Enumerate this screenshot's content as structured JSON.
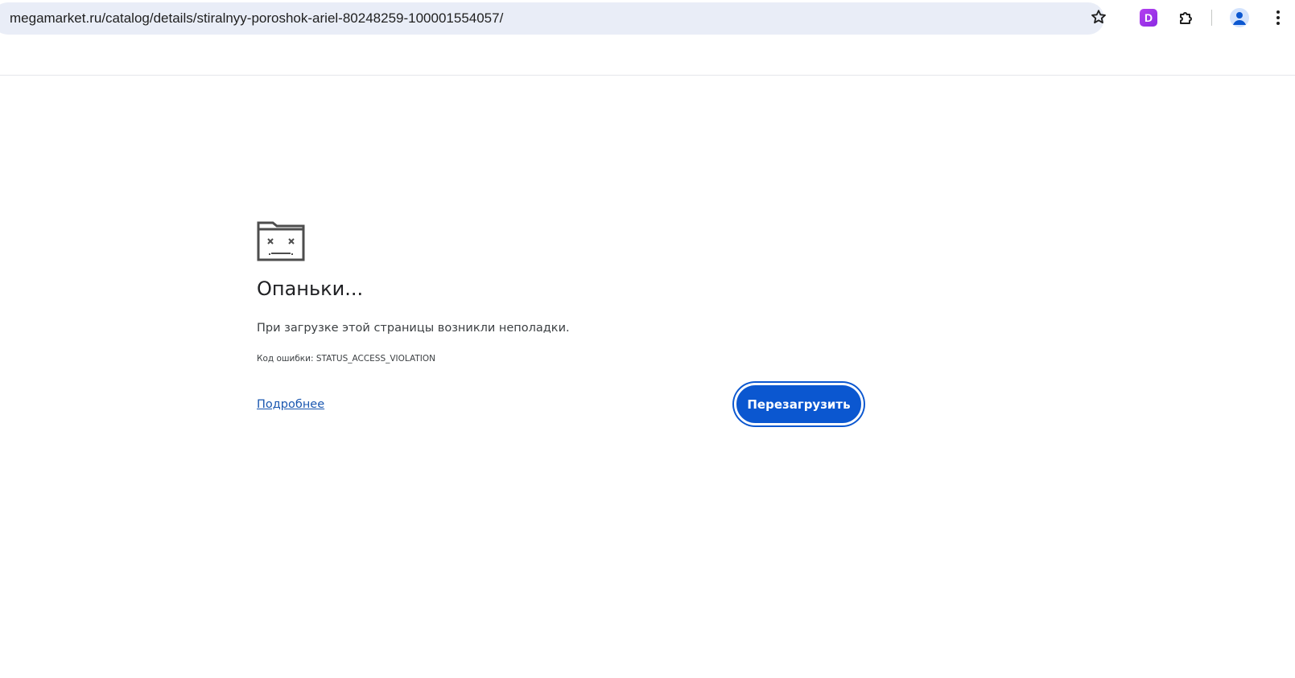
{
  "browser": {
    "url": "megamarket.ru/catalog/details/stiralnyy-poroshok-ariel-80248259-100001554057/",
    "extension_letter": "D",
    "icons": {
      "bookmark": "star-icon",
      "extension": "puzzle-icon",
      "profile": "avatar-icon",
      "menu": "kebab-menu-icon"
    }
  },
  "error_page": {
    "icon": "sad-tab-icon",
    "title": "Опаньки...",
    "message": "При загрузке этой страницы возникли неполадки.",
    "error_code": "Код ошибки: STATUS_ACCESS_VIOLATION",
    "details_link": "Подробнее",
    "reload_button": "Перезагрузить"
  },
  "colors": {
    "accent": "#0b57d0",
    "link": "#1a57b0",
    "omnibox_bg": "#e9edf7"
  }
}
